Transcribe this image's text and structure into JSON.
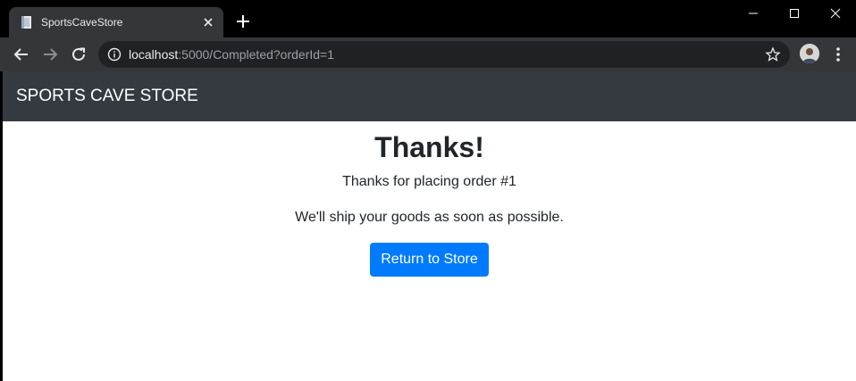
{
  "browser": {
    "tab_title": "SportsCaveStore",
    "tab_close_icon": "close-icon",
    "new_tab_icon": "plus-icon",
    "url_host": "localhost",
    "url_rest": ":5000/Completed?orderId=1",
    "window_controls": [
      "minimize-icon",
      "maximize-icon",
      "close-icon"
    ],
    "colors": {
      "frame": "#000000",
      "toolbar": "#35363a",
      "omnibox": "#202124"
    }
  },
  "page": {
    "brand": "SPORTS CAVE STORE",
    "heading": "Thanks!",
    "order_message": "Thanks for placing order #1",
    "ship_message": "We'll ship your goods as soon as possible.",
    "return_button": "Return to Store",
    "colors": {
      "navbar": "#343a40",
      "button": "#007bff",
      "text": "#212529"
    }
  }
}
